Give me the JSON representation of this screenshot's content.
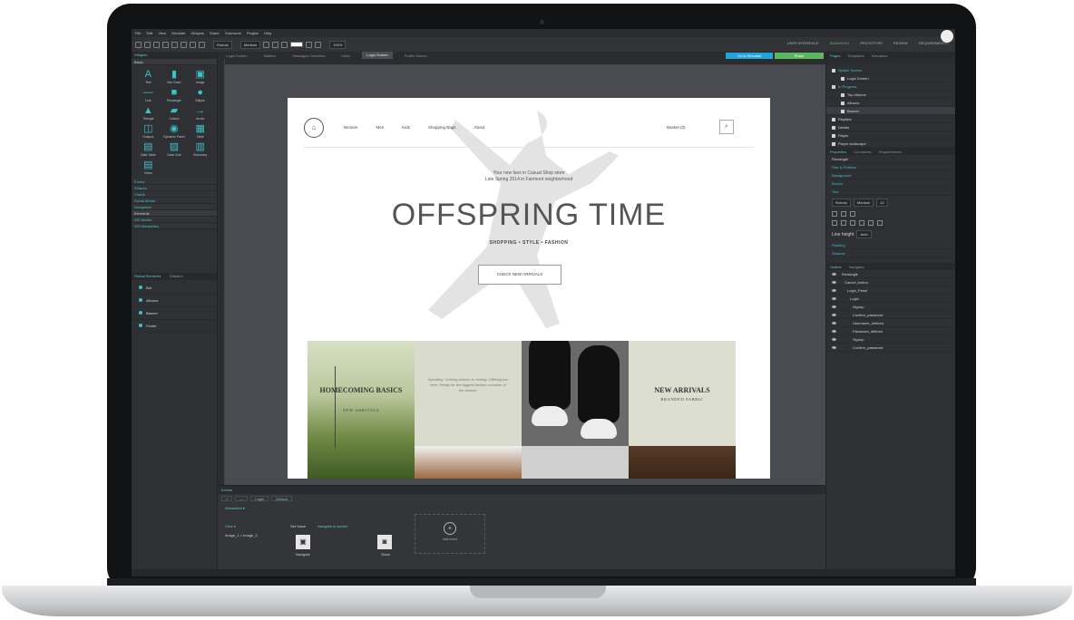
{
  "menu": [
    "File",
    "Edit",
    "View",
    "Simulate",
    "Widgets",
    "Share",
    "Teamwork",
    "Plugins",
    "Help"
  ],
  "toolbar": {
    "font": "Roboto",
    "weight": "Medium",
    "zoom": "100%"
  },
  "top_right_menu": [
    "USER INTERFACE",
    "ADVANCED",
    "PROTOTYPE",
    "REVIEW",
    "REQUIREMENTS"
  ],
  "tabs": [
    "Login Screen",
    "Mailbox",
    "Messages Overview",
    "Inbox",
    "Login Screen",
    "Profile Screen"
  ],
  "actions": {
    "simulate": "Go to Simulate",
    "share": "Share"
  },
  "left_panel": {
    "header": "Widgets",
    "section": "Basic",
    "widgets": [
      {
        "icon": "text-icon",
        "label": "Text",
        "glyph": "A"
      },
      {
        "icon": "bar-chart-icon",
        "label": "Bar Chart",
        "glyph": "▮"
      },
      {
        "icon": "image-icon",
        "label": "Image",
        "glyph": "▣"
      },
      {
        "icon": "link-icon",
        "label": "Link",
        "glyph": "—"
      },
      {
        "icon": "rectangle-icon",
        "label": "Rectangle",
        "glyph": "■"
      },
      {
        "icon": "ellipse-icon",
        "label": "Ellipse",
        "glyph": "●"
      },
      {
        "icon": "triangle-icon",
        "label": "Triangle",
        "glyph": "▲"
      },
      {
        "icon": "callout-icon",
        "label": "Callout",
        "glyph": "▰"
      },
      {
        "icon": "arrow-icon",
        "label": "Arrow",
        "glyph": "→"
      },
      {
        "icon": "hotspot-icon",
        "label": "Hotspot",
        "glyph": "◫"
      },
      {
        "icon": "dynamic-panel-icon",
        "label": "Dynamic Panel",
        "glyph": "◉"
      },
      {
        "icon": "table-icon",
        "label": "Table",
        "glyph": "▦"
      },
      {
        "icon": "data-table-icon",
        "label": "Data Table",
        "glyph": "▤"
      },
      {
        "icon": "data-grid-icon",
        "label": "Data Grid",
        "glyph": "▨"
      },
      {
        "icon": "summary-icon",
        "label": "Summary",
        "glyph": "▥"
      },
      {
        "icon": "video-icon",
        "label": "Video",
        "glyph": "▤"
      }
    ],
    "categories": [
      "Forms",
      "Shapes",
      "Charts",
      "Social Media",
      "Navigation"
    ],
    "categories2_header": "Elements",
    "categories2": [
      "iOS Mobile",
      "iOS Wearables"
    ],
    "tree_header": "Global Elements",
    "tree_tab": "Masters",
    "tree_items": [
      "Bar",
      "Albums",
      "Banner",
      "Footer"
    ]
  },
  "page": {
    "nav": [
      "Women",
      "Men",
      "Kids",
      "Shopping Bags",
      "About"
    ],
    "cart": "Basket (0)",
    "hero_text_1": "Your new favs in Casual Shop store",
    "hero_text_2": "Late Spring 2014 in Fairmont neighborhood",
    "title": "OFFSPRING TIME",
    "subtitle": "SHOPPING  •  STYLE  •  FASHION",
    "button": "CHECK NEW ARRIVALS",
    "tile1_title": "HOMECOMING BASICS",
    "tile1_sub": "NEW ARRIVALS",
    "tile2_body": "Spending. Coming season is coming. Offering you here. Ready for the biggest fashion occasion of the season.",
    "tile4_title": "NEW ARRIVALS",
    "tile4_sub": "BRANDED FABRIC"
  },
  "right_panel": {
    "tabs": [
      "Pages",
      "Templates",
      "Scenarios"
    ],
    "pages": [
      {
        "label": "Splash Screen",
        "indent": 0,
        "teal": true
      },
      {
        "label": "Login Screen",
        "indent": 1
      },
      {
        "label": "In Progress",
        "indent": 0,
        "teal": true
      },
      {
        "label": "Top Albums",
        "indent": 1
      },
      {
        "label": "Albums",
        "indent": 1
      },
      {
        "label": "Banner",
        "indent": 1,
        "selected": true
      },
      {
        "label": "Playlists",
        "indent": 0
      },
      {
        "label": "Details",
        "indent": 0
      },
      {
        "label": "Player",
        "indent": 0
      },
      {
        "label": "Player landscape",
        "indent": 0
      }
    ],
    "props_tabs": [
      "Properties",
      "Comments",
      "Requirements"
    ],
    "props_rows": [
      "Rectangle",
      "Size & Position",
      "Background",
      "Border",
      "Text"
    ],
    "text_font": "Roboto",
    "text_weight": "Medium",
    "text_size": "12",
    "line_height_label": "Line height",
    "line_height": "Auto",
    "more_rows": [
      "Padding",
      "Shadow"
    ],
    "outline_tabs": [
      "Outline",
      "Navigator"
    ],
    "outline": [
      "Rectangle",
      "Cancel_button",
      "Login_Panel",
      "Login",
      "Signup",
      "Confirm_password",
      "Username_defined",
      "Password_defined",
      "Signup",
      "Confirm_password"
    ]
  },
  "events": {
    "header": "Events",
    "tabs": [
      "+",
      "—",
      "Login",
      "Default"
    ],
    "event_label": "Interaction ▾",
    "cond": "Click ▾",
    "cond_detail": "Image_1 = Image_2",
    "action1": "Set Value",
    "action2": "Navigate to screen",
    "icon1_label": "Navigate",
    "icon2_label": "Show",
    "add_label": "Add event"
  }
}
